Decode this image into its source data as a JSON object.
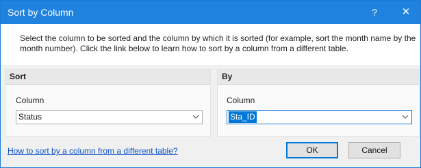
{
  "window": {
    "title": "Sort by Column",
    "help_glyph": "?",
    "close_glyph": "✕"
  },
  "description": "Select the column to be sorted and the column by which it is sorted (for example, sort the month name by the month number). Click the link below to learn how to sort by a column from a different table.",
  "sort_panel": {
    "header": "Sort",
    "column_label": "Column",
    "column_value": "Status"
  },
  "by_panel": {
    "header": "By",
    "column_label": "Column",
    "column_value": "Sta_ID"
  },
  "footer": {
    "help_link": "How to sort by a column from a different table?",
    "ok_label": "OK",
    "cancel_label": "Cancel"
  },
  "icons": {
    "dropdown": "chevron-down-icon"
  },
  "colors": {
    "titlebar": "#1e82de",
    "link": "#0a52c8",
    "selection": "#0078d7"
  }
}
